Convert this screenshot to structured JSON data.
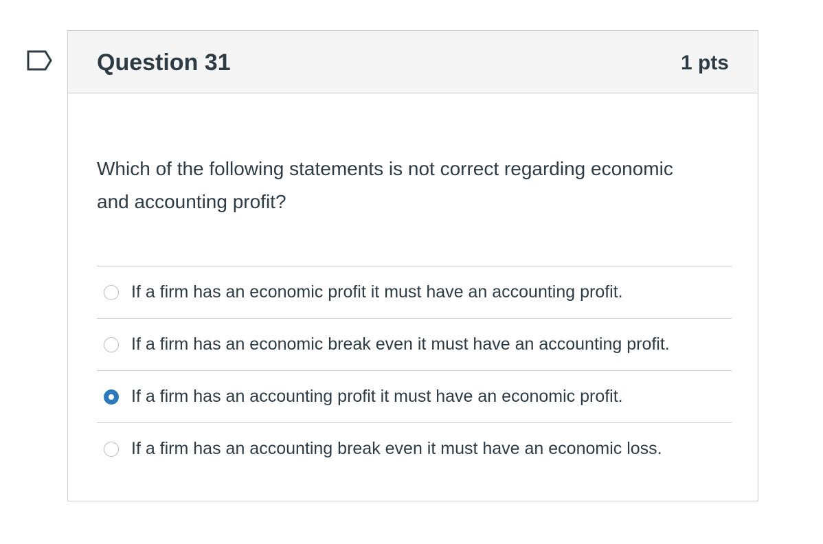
{
  "question": {
    "title": "Question 31",
    "points": "1 pts",
    "text": "Which of the following statements is not correct regarding economic and accounting profit?",
    "flag_icon": "flag-icon",
    "answers": [
      {
        "label": "If a firm has an economic profit it must have an accounting profit.",
        "selected": false
      },
      {
        "label": "If a firm has an economic break even it must have an accounting profit.",
        "selected": false
      },
      {
        "label": "If a firm has an accounting profit it must have an economic profit.",
        "selected": true
      },
      {
        "label": "If a firm has an accounting break even it must have an economic loss.",
        "selected": false
      }
    ],
    "accent_color": "#2b7abc"
  }
}
